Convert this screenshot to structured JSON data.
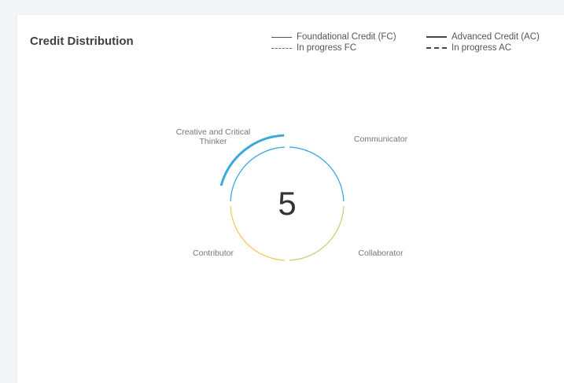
{
  "card": {
    "title": "Credit Distribution"
  },
  "legend": {
    "foundational_credit": "Foundational Credit (FC)",
    "in_progress_fc": "In progress FC",
    "advanced_credit": "Advanced Credit (AC)",
    "in_progress_ac": "In progress AC"
  },
  "center_value": "5",
  "segments": [
    {
      "label_lines": [
        "Communicator"
      ],
      "color": "#3ba9dc"
    },
    {
      "label_lines": [
        "Collaborator"
      ],
      "color": "#b8d97a"
    },
    {
      "label_lines": [
        "Contributor"
      ],
      "color": "#f7c95c"
    },
    {
      "label_lines": [
        "Creative and Critical",
        "Thinker"
      ],
      "color": "#3ba9dc"
    }
  ],
  "advanced_segment_index": 3,
  "advanced_fraction": 0.85
}
